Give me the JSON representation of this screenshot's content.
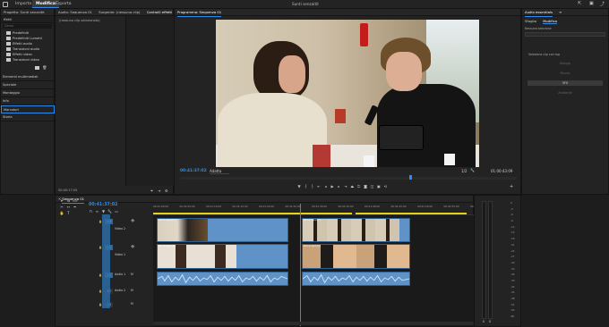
{
  "app": {
    "menu_tabs": [
      "Importa",
      "Modifica",
      "Esporta"
    ],
    "active_tab": "Modifica",
    "window_title": "Sunti senzaitit"
  },
  "project": {
    "title": "Progetto: Sunti senzaitit",
    "header2": "ffetti",
    "items": [
      "Predefiniti",
      "Predefiniti Lumetri",
      "Effetti audio",
      "Transizioni audio",
      "Effetti video",
      "Transizioni video"
    ],
    "sections": [
      "Elementi multimediali",
      "Speciale",
      "Montaggio",
      "Info",
      "Marcatori",
      "Storia"
    ],
    "search_placeholder": "Cerca"
  },
  "source_panel": {
    "tabs": [
      "Audio: Sequenza 01",
      "Sorgente: (nessuna clip)",
      "Controlli effetti"
    ],
    "active": "Controlli effetti",
    "message": "(nessuna clip selezionata)",
    "timecode": "00:00:17:05"
  },
  "program": {
    "title": "Programma: Sequenza 01",
    "timecode": "00:41:37:02",
    "fit": "Adatta",
    "scale": "1/2",
    "duration": "01:00:43:09"
  },
  "right_panel": {
    "title": "Audio essentials",
    "tabs": [
      "Sfoglia",
      "Modifica"
    ],
    "active_tab": "Modifica",
    "preset_label": "Nessuna selezione",
    "message": "Seleziona clip con tag",
    "buttons": [
      "Dialogo",
      "Musica",
      "SFX",
      "Ambiente"
    ]
  },
  "timeline": {
    "title": "Sequenza 01",
    "timecode": "00:41:37:02",
    "ruler": [
      "00:41:00:00",
      "00:41:05:00",
      "00:41:10:00",
      "00:41:15:00",
      "00:41:20:00",
      "00:41:25:00",
      "00:41:30:00",
      "00:41:35:00",
      "00:41:40:00",
      "00:41:45:00",
      "00:41:50:00",
      "00:41:55:00",
      "00:42:00:00"
    ],
    "tracks": [
      {
        "id": "V2",
        "name": "Video 2"
      },
      {
        "id": "V1",
        "name": "Video 1"
      },
      {
        "id": "A1",
        "name": "Audio 1"
      },
      {
        "id": "A2",
        "name": "Audio 2"
      },
      {
        "id": "A3",
        "name": ""
      }
    ],
    "clip_labels": [
      "Pod 1.mp4 [V]",
      "Pod 2.mp4 [V]",
      "Pod 3.mp4 [V]",
      "Pod 4.mp4 [V]"
    ]
  },
  "meter": {
    "scale": [
      "0",
      "-3",
      "-6",
      "-9",
      "-12",
      "-15",
      "-18",
      "-21",
      "-24",
      "-27",
      "-30",
      "-33",
      "-36",
      "-39",
      "-42",
      "-45",
      "-48",
      "-51",
      "-54",
      "dB"
    ],
    "channels": [
      "S",
      "S"
    ]
  },
  "colors": {
    "accent": "#2d8ceb",
    "video_clip": "#5f93c7",
    "audio_clip": "#5f93c7",
    "playhead": "#2d8ceb",
    "work_area": "#e6d21a"
  }
}
